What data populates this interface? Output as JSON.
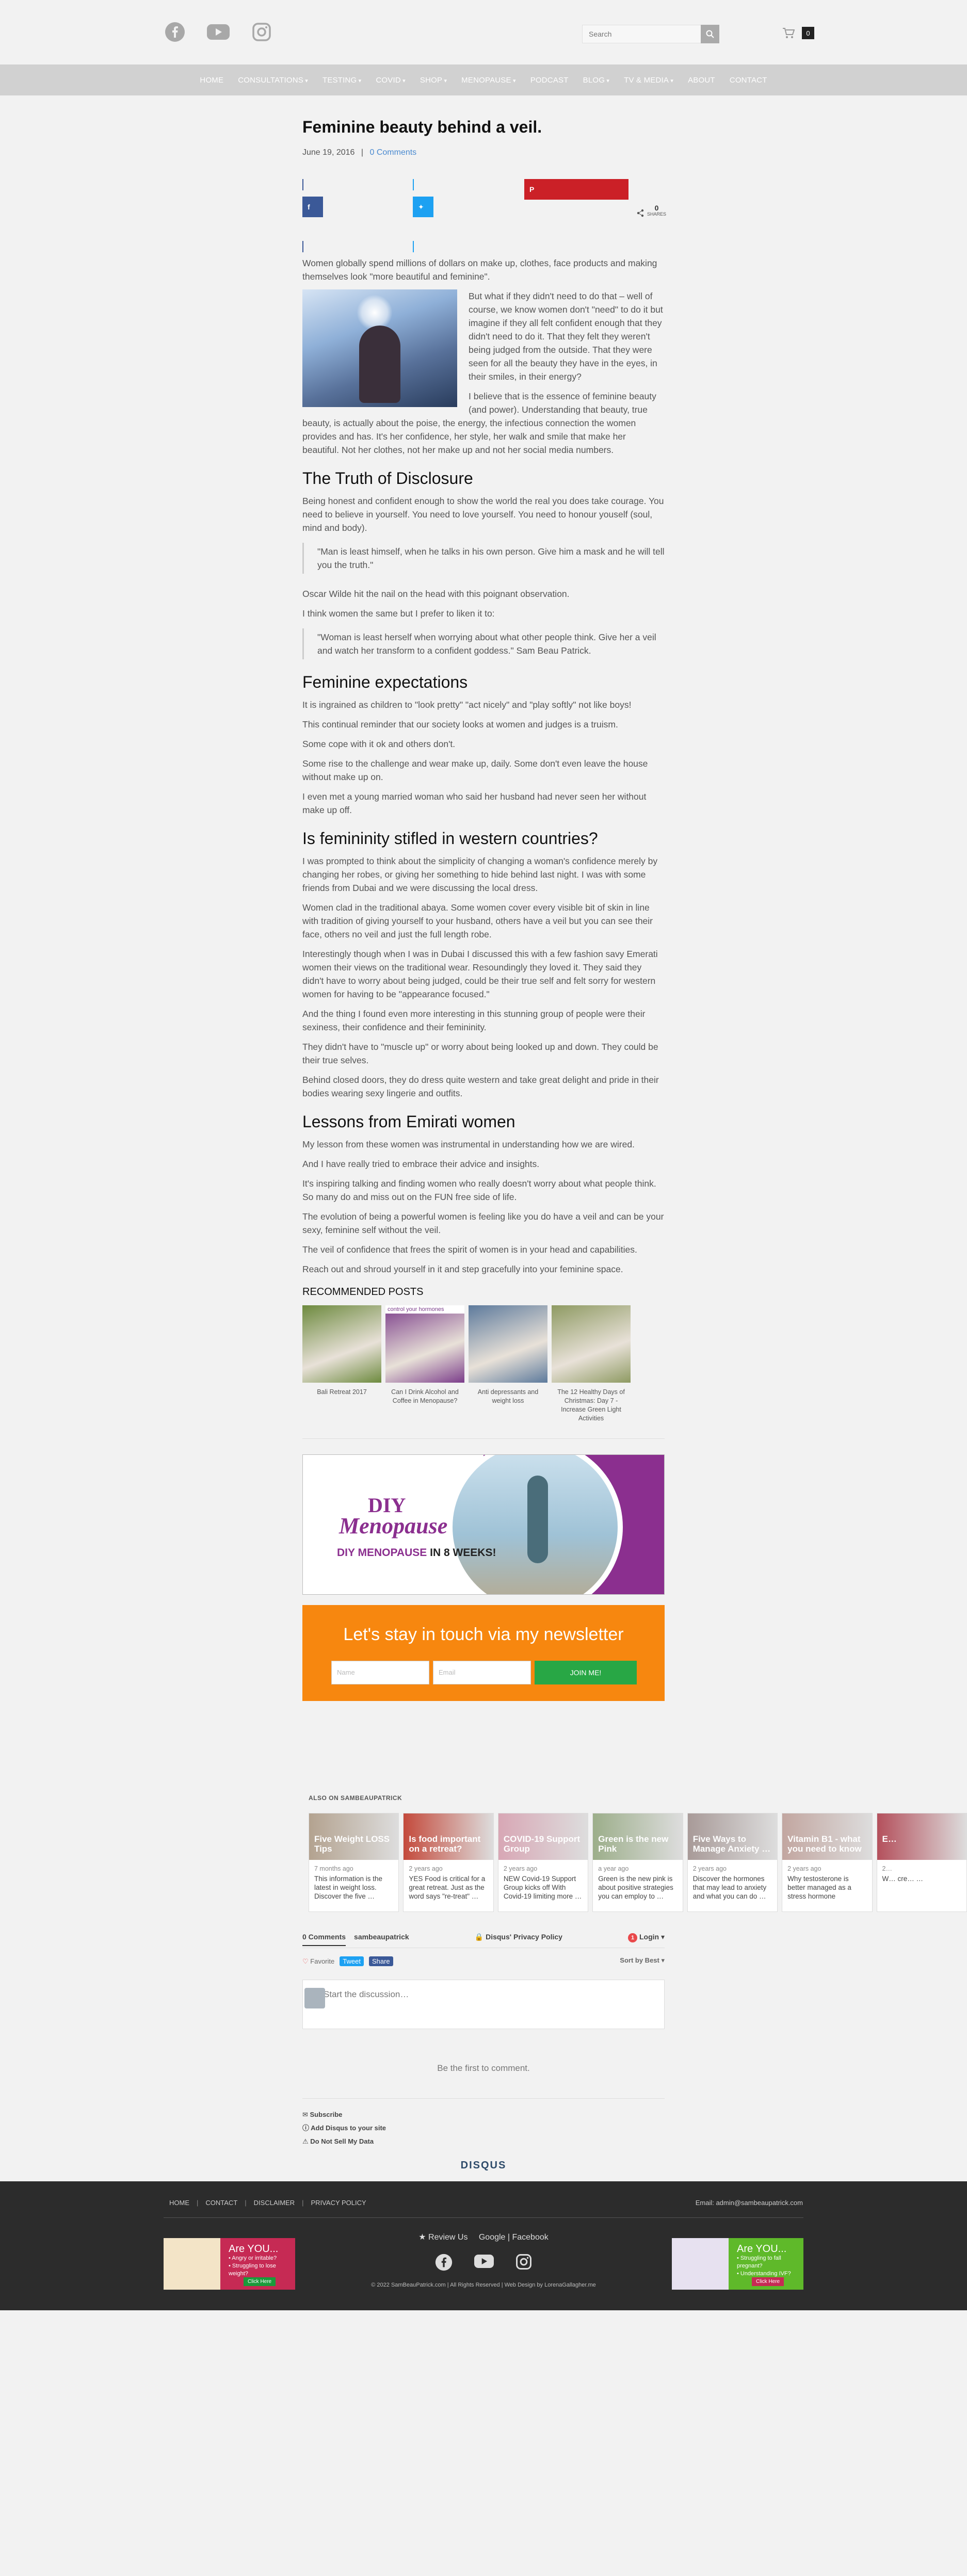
{
  "header": {
    "search_placeholder": "Search",
    "cart_count": "0"
  },
  "nav": [
    "HOME",
    "CONSULTATIONS",
    "TESTING",
    "COVID",
    "SHOP",
    "MENOPAUSE",
    "PODCAST",
    "BLOG",
    "TV & MEDIA",
    "ABOUT",
    "CONTACT"
  ],
  "nav_dropdown": [
    false,
    true,
    true,
    true,
    true,
    true,
    false,
    true,
    true,
    false,
    false
  ],
  "article": {
    "title": "Feminine beauty behind a veil.",
    "date": "June 19, 2016",
    "sep": "|",
    "comments": "0 Comments",
    "share_count": "0",
    "share_label": "SHARES",
    "intro": "Women globally spend millions of dollars on make up, clothes, face products and making themselves look \"more beautiful and feminine\".",
    "p_wrap": "But what if they didn't need to do that – well of course, we know women don't \"need\" to do it but imagine if they all felt confident enough that they didn't need to do it. That they felt they weren't being judged from the outside. That they were seen for all the beauty they have in the eyes, in their smiles, in their energy?",
    "p_believe": "I believe that is the essence of feminine beauty (and power). Understanding that beauty, true beauty, is actually about the poise, the energy, the infectious connection the women provides and has. It's her confidence, her style, her walk and smile that make her beautiful. Not her clothes, not her make up and not her social media numbers.",
    "h_truth": "The Truth of Disclosure",
    "p_honest": "Being honest and confident enough to show the world the real you does take courage. You need to believe in yourself. You need to love yourself. You need to honour youself (soul, mind and body).",
    "q1": "\"Man is least himself, when he talks in his own person. Give him a mask and he will tell you the truth.\"",
    "p_oscar": "Oscar Wilde hit the nail on the head with this poignant observation.",
    "p_think": "I think women the same but I prefer to liken it to:",
    "q2": "\"Woman is least herself when worrying about what other people think. Give her a veil and watch her transform to a confident goddess.\" Sam Beau Patrick.",
    "h_expect": "Feminine expectations",
    "p_e1": "It is ingrained as children to \"look pretty\" \"act nicely\" and \"play softly\" not like boys!",
    "p_e2": "This continual reminder that our society looks at women and judges is a truism.",
    "p_e3": "Some cope with it ok and others don't.",
    "p_e4": "Some rise to the challenge and wear make up, daily. Some don't even leave the house without make up on.",
    "p_e5": "I even met a young married woman who said her husband had never seen her without make up off.",
    "h_stifled": "Is femininity stifled in western countries?",
    "p_s1": "I was prompted to think about the simplicity of changing a woman's confidence merely by changing her robes, or giving her something to hide behind last night. I was with some friends from Dubai and we were discussing the local dress.",
    "p_s2": "Women clad in the traditional abaya. Some women cover every visible bit of skin in line with tradition of giving yourself to your husband, others have a veil but you can see their face, others no veil and just the full length robe.",
    "p_s3": "Interestingly though when I was in Dubai I discussed this with a few fashion savy Emerati women their views on the traditional wear. Resoundingly they loved it. They said they didn't have to worry about being judged, could be their true self and felt sorry for western women for having to be \"appearance focused.\"",
    "p_s4": "And the thing I found even more interesting in this stunning group of people were their sexiness, their confidence and their femininity.",
    "p_s5": "They didn't have to \"muscle up\" or worry about being looked up and down. They could be their true selves.",
    "p_s6": "Behind closed doors, they do dress quite western and take great delight and pride in their bodies wearing sexy lingerie and outfits.",
    "h_lessons": "Lessons from Emirati women",
    "p_l1": "My lesson from these women was instrumental in understanding how we are wired.",
    "p_l2": "And I have really tried to embrace their advice and insights.",
    "p_l3": "It's inspiring talking and finding women who really doesn't worry about what people think. So many do and miss out on the FUN free side of life.",
    "p_l4": "The evolution of being a powerful women is feeling like you do have a veil and can be your sexy, feminine self without the veil.",
    "p_l5": "The veil of confidence that frees the spirit of women is in your head and capabilities.",
    "p_l6": "Reach out and shroud yourself in it and step gracefully into your feminine space."
  },
  "recommended": {
    "title": "RECOMMENDED POSTS",
    "items": [
      {
        "caption": "Bali Retreat 2017",
        "color": "#6d8a3e"
      },
      {
        "caption": "Can I Drink Alcohol and Coffee in Menopause?",
        "color": "#7b3d8a",
        "overlay": "control your hormones"
      },
      {
        "caption": "Anti depressants and weight loss",
        "color": "#5d7a9c"
      },
      {
        "caption": "The 12 Healthy Days of Christmas: Day 7 - Increase Green Light Activities",
        "color": "#8e9a62"
      }
    ]
  },
  "banner": {
    "title1": "DIY",
    "title2": "Menopause",
    "sub1": "DIY MENOPAUSE",
    "sub2": "IN 8 WEEKS!"
  },
  "newsletter": {
    "heading": "Let's stay in touch via my newsletter",
    "name_ph": "Name",
    "email_ph": "Email",
    "button": "JOIN ME!"
  },
  "also": {
    "title": "ALSO ON SAMBEAUPATRICK",
    "cards": [
      {
        "title": "Five Weight LOSS Tips",
        "ago": "7 months ago",
        "desc": "This information is the latest in weight loss. Discover the five …",
        "color": "#b3a28f"
      },
      {
        "title": "Is food important on a retreat?",
        "ago": "2 years ago",
        "desc": "YES Food is critical for a great retreat. Just as the word says \"re-treat\" …",
        "color": "#c44a3c"
      },
      {
        "title": "COVID-19 Support Group",
        "ago": "2 years ago",
        "desc": "NEW Covid-19 Support Group kicks off With Covid-19 limiting more …",
        "color": "#d8a7b5"
      },
      {
        "title": "Green is the new Pink",
        "ago": "a year ago",
        "desc": "Green is the new pink is about positive strategies you can employ to …",
        "color": "#9cae8a"
      },
      {
        "title": "Five Ways to Manage Anxiety …",
        "ago": "2 years ago",
        "desc": "Discover the hormones that may lead to anxiety and what you can do …",
        "color": "#a89a98"
      },
      {
        "title": "Vitamin B1 - what you need to know",
        "ago": "2 years ago",
        "desc": "Why testosterone is better managed as a stress hormone",
        "color": "#c2a6a0"
      },
      {
        "title": "E…",
        "ago": "2…",
        "desc": "W… cre… …",
        "color": "#b4505c"
      }
    ]
  },
  "disqus": {
    "comments": "0 Comments",
    "site": "sambeaupatrick",
    "privacy": "Disqus' Privacy Policy",
    "login": "Login",
    "favorite": "Favorite",
    "tweet": "Tweet",
    "share": "Share",
    "sort": "Sort by Best",
    "placeholder": "Start the discussion…",
    "first": "Be the first to comment.",
    "subscribe": "Subscribe",
    "add": "Add Disqus to your site",
    "dnsmd": "Do Not Sell My Data",
    "logo": "DISQUS"
  },
  "footer": {
    "links": [
      "HOME",
      "CONTACT",
      "DISCLAIMER",
      "PRIVACY POLICY"
    ],
    "email": "Email: admin@sambeaupatrick.com",
    "review": "★ Review Us",
    "google": "Google",
    "facebook": "Facebook",
    "copyright": "© 2022 SamBeauPatrick.com | All Rights Reserved | Web Design by LorenaGallagher.me",
    "ad_left": {
      "line1": "Are YOU...",
      "line2": "• Angry or irritable?",
      "line3": "• Struggling to lose weight?",
      "btn": "Click Here"
    },
    "ad_right": {
      "line1": "Are YOU...",
      "line2": "• Struggling to fall pregnant?",
      "line3": "• Understanding IVF?",
      "btn": "Click Here"
    }
  }
}
